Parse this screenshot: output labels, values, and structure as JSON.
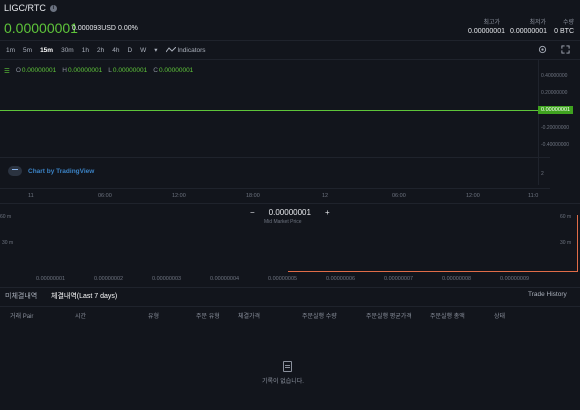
{
  "header": {
    "pair": "LIGC/RTC",
    "price": "0.00000001",
    "usd": "0.000093USD",
    "change": "0.00%",
    "stats": [
      {
        "label": "최고가",
        "value": "0.00000001"
      },
      {
        "label": "최저가",
        "value": "0.00000001"
      },
      {
        "label": "수량",
        "value": "0 BTC"
      }
    ]
  },
  "toolbar": {
    "intervals": [
      "1m",
      "5m",
      "15m",
      "30m",
      "1h",
      "2h",
      "4h",
      "D",
      "W"
    ],
    "active": "15m",
    "dropdown": "▾",
    "indicators": "Indicators"
  },
  "ohlc": {
    "o": "0.00000001",
    "h": "0.00000001",
    "l": "0.00000001",
    "c": "0.00000001"
  },
  "yaxis": [
    "0.40000000",
    "0.20000000",
    "-0.20000000",
    "-0.40000000"
  ],
  "yaxis_lower": "2",
  "last_price_tag": "0.00000001",
  "tv_label": "Chart by TradingView",
  "xaxis": [
    "11",
    "06:00",
    "12:00",
    "18:00",
    "12",
    "06:00",
    "12:00",
    "11:0"
  ],
  "depth": {
    "mid_value": "0.00000001",
    "mid_label": "Mid Market Price",
    "minus": "−",
    "plus": "+",
    "y_left": [
      "60 m",
      "30 m"
    ],
    "y_right": [
      "60 m",
      "30 m"
    ],
    "x": [
      "0.00000001",
      "0.00000002",
      "0.00000003",
      "0.00000004",
      "0.00000005",
      "0.00000006",
      "0.00000007",
      "0.00000008",
      "0.00000009"
    ]
  },
  "orders": {
    "tabs": [
      "미체결내역",
      "체결내역(Last 7 days)"
    ],
    "history": "Trade History",
    "columns": [
      "거래 Pair",
      "시간",
      "유형",
      "주문 유형",
      "체결가격",
      "주문실행 수량",
      "주문실행 평균가격",
      "주문실행 총액",
      "상태"
    ],
    "empty": "기록이 없습니다."
  }
}
